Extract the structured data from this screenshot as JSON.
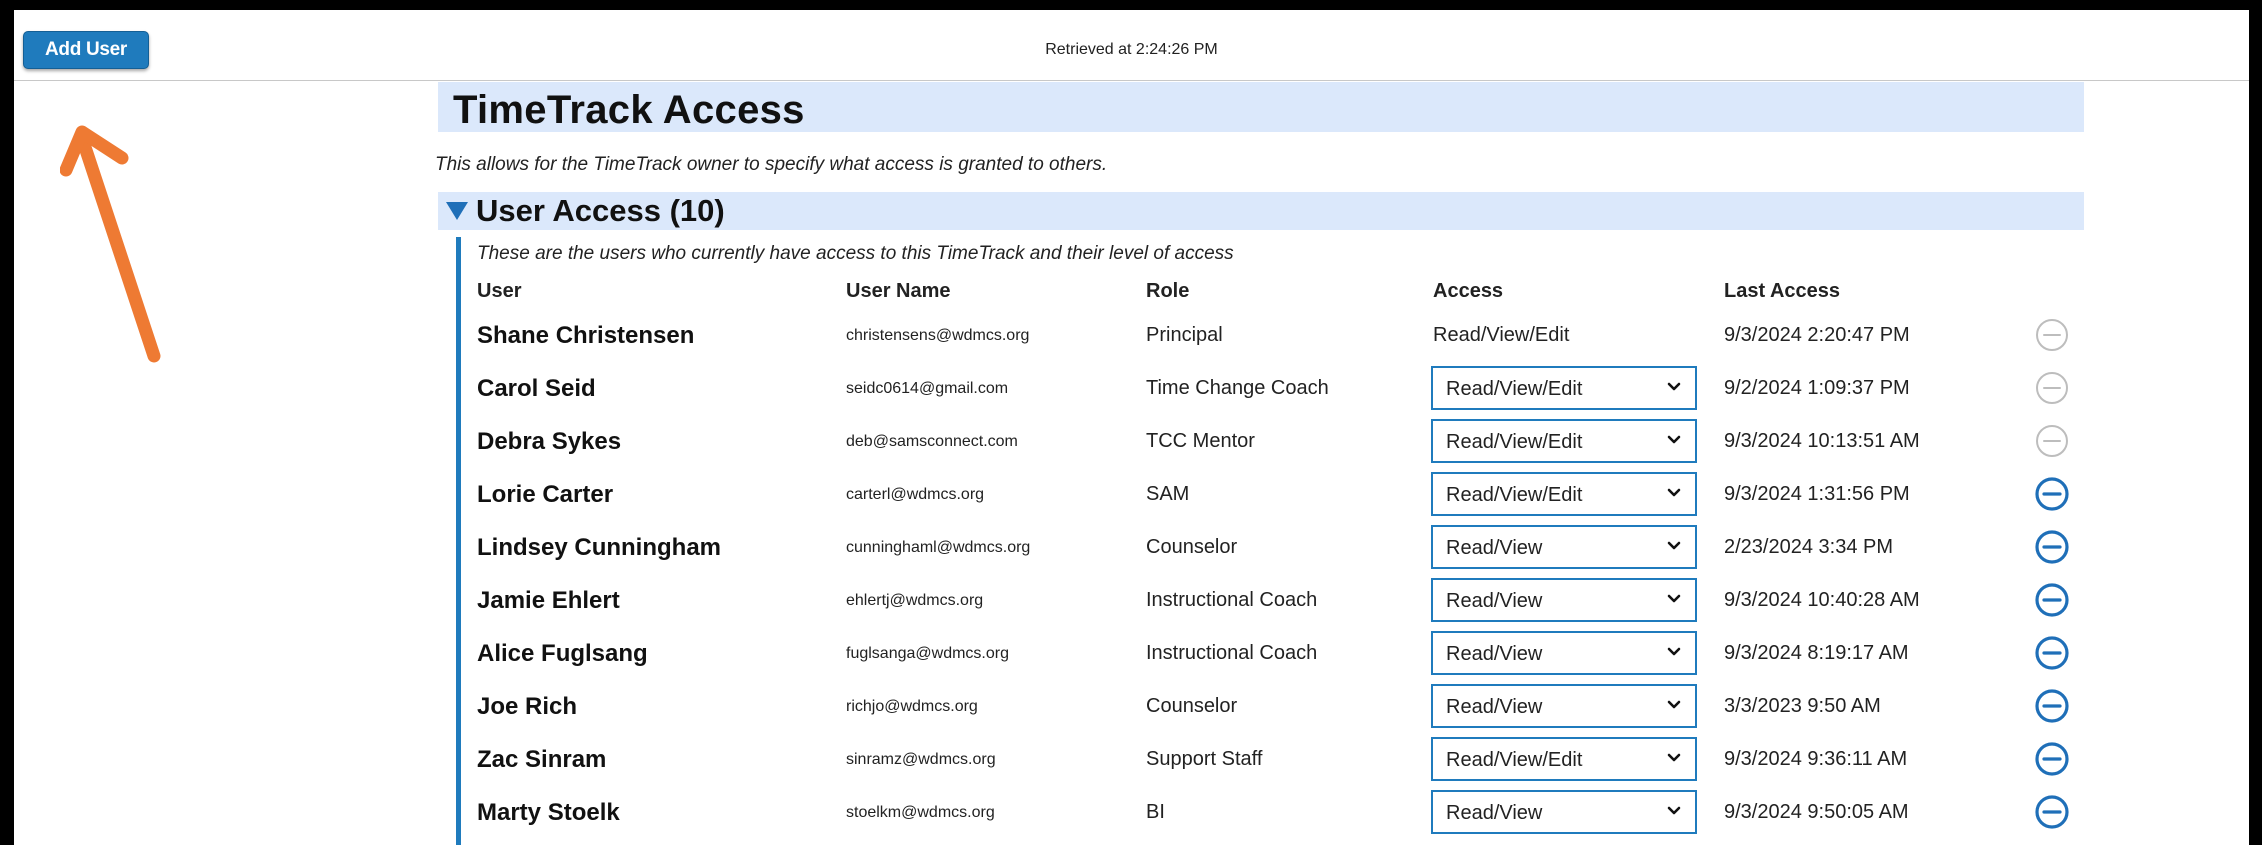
{
  "toolbar": {
    "add_user_label": "Add User",
    "retrieved_text": "Retrieved at 2:24:26 PM"
  },
  "page": {
    "title": "TimeTrack Access",
    "description": "This allows for the TimeTrack owner to specify what access is granted to others."
  },
  "section": {
    "title": "User Access (10)",
    "description": "These are the users who currently have access to this TimeTrack and their level of access",
    "toggle_icon": "triangle-down-icon"
  },
  "table": {
    "columns": [
      "User",
      "User Name",
      "Role",
      "Access",
      "Last Access"
    ],
    "rows": [
      {
        "user": "Shane Christensen",
        "username": "christensens@wdmcs.org",
        "role": "Principal",
        "access": "Read/View/Edit",
        "editable": false,
        "last_access": "9/3/2024 2:20:47 PM",
        "remove_enabled": false
      },
      {
        "user": "Carol Seid",
        "username": "seidc0614@gmail.com",
        "role": "Time Change Coach",
        "access": "Read/View/Edit",
        "editable": true,
        "last_access": "9/2/2024 1:09:37 PM",
        "remove_enabled": false
      },
      {
        "user": "Debra Sykes",
        "username": "deb@samsconnect.com",
        "role": "TCC Mentor",
        "access": "Read/View/Edit",
        "editable": true,
        "last_access": "9/3/2024 10:13:51 AM",
        "remove_enabled": false
      },
      {
        "user": "Lorie Carter",
        "username": "carterl@wdmcs.org",
        "role": "SAM",
        "access": "Read/View/Edit",
        "editable": true,
        "last_access": "9/3/2024 1:31:56 PM",
        "remove_enabled": true
      },
      {
        "user": "Lindsey Cunningham",
        "username": "cunninghaml@wdmcs.org",
        "role": "Counselor",
        "access": "Read/View",
        "editable": true,
        "last_access": "2/23/2024 3:34 PM",
        "remove_enabled": true
      },
      {
        "user": "Jamie Ehlert",
        "username": "ehlertj@wdmcs.org",
        "role": "Instructional Coach",
        "access": "Read/View",
        "editable": true,
        "last_access": "9/3/2024 10:40:28 AM",
        "remove_enabled": true
      },
      {
        "user": "Alice Fuglsang",
        "username": "fuglsanga@wdmcs.org",
        "role": "Instructional Coach",
        "access": "Read/View",
        "editable": true,
        "last_access": "9/3/2024 8:19:17 AM",
        "remove_enabled": true
      },
      {
        "user": "Joe Rich",
        "username": "richjo@wdmcs.org",
        "role": "Counselor",
        "access": "Read/View",
        "editable": true,
        "last_access": "3/3/2023 9:50 AM",
        "remove_enabled": true
      },
      {
        "user": "Zac Sinram",
        "username": "sinramz@wdmcs.org",
        "role": "Support Staff",
        "access": "Read/View/Edit",
        "editable": true,
        "last_access": "9/3/2024 9:36:11 AM",
        "remove_enabled": true
      },
      {
        "user": "Marty Stoelk",
        "username": "stoelkm@wdmcs.org",
        "role": "BI",
        "access": "Read/View",
        "editable": true,
        "last_access": "9/3/2024 9:50:05 AM",
        "remove_enabled": true
      }
    ]
  },
  "colors": {
    "accent": "#1f7bbd",
    "header_band": "#dbe8fb",
    "annotation_arrow": "#ee7a33",
    "remove_disabled": "#bdbdbd",
    "remove_enabled": "#1f6fb8"
  },
  "icons": {
    "remove": "minus-circle-icon",
    "dropdown": "chevron-down-icon",
    "annotation": "annotation-arrow-icon"
  }
}
